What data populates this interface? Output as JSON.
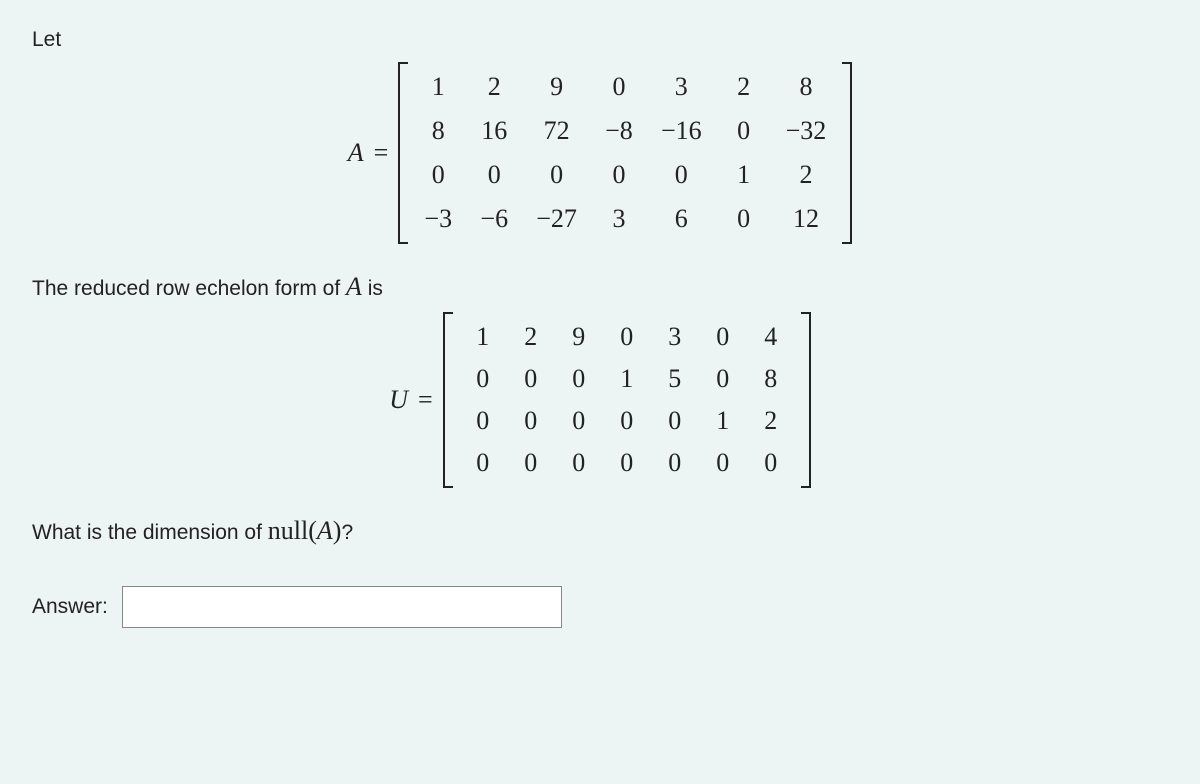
{
  "intro_text": "Let",
  "matrix_a_label": "A",
  "equals": "=",
  "matrix_a": [
    [
      "1",
      "2",
      "9",
      "0",
      "3",
      "2",
      "8"
    ],
    [
      "8",
      "16",
      "72",
      "−8",
      "−16",
      "0",
      "−32"
    ],
    [
      "0",
      "0",
      "0",
      "0",
      "0",
      "1",
      "2"
    ],
    [
      "−3",
      "−6",
      "−27",
      "3",
      "6",
      "0",
      "12"
    ]
  ],
  "rref_text_pre": "The reduced row echelon form of ",
  "rref_text_mid": "A",
  "rref_text_post": " is",
  "matrix_u_label": "U",
  "matrix_u": [
    [
      "1",
      "2",
      "9",
      "0",
      "3",
      "0",
      "4"
    ],
    [
      "0",
      "0",
      "0",
      "1",
      "5",
      "0",
      "8"
    ],
    [
      "0",
      "0",
      "0",
      "0",
      "0",
      "1",
      "2"
    ],
    [
      "0",
      "0",
      "0",
      "0",
      "0",
      "0",
      "0"
    ]
  ],
  "question_pre": "What is the dimension of ",
  "question_null": "null",
  "question_paren_open": "(",
  "question_A": "A",
  "question_paren_close": ")",
  "question_post": "?",
  "answer_label": "Answer:",
  "answer_value": "",
  "chart_data": {
    "type": "table",
    "title": "Linear algebra problem: dimension of null space",
    "matrices": {
      "A": {
        "rows": 4,
        "cols": 7,
        "data": [
          [
            1,
            2,
            9,
            0,
            3,
            2,
            8
          ],
          [
            8,
            16,
            72,
            -8,
            -16,
            0,
            -32
          ],
          [
            0,
            0,
            0,
            0,
            0,
            1,
            2
          ],
          [
            -3,
            -6,
            -27,
            3,
            6,
            0,
            12
          ]
        ]
      },
      "U": {
        "rows": 4,
        "cols": 7,
        "data": [
          [
            1,
            2,
            9,
            0,
            3,
            0,
            4
          ],
          [
            0,
            0,
            0,
            1,
            5,
            0,
            8
          ],
          [
            0,
            0,
            0,
            0,
            0,
            1,
            2
          ],
          [
            0,
            0,
            0,
            0,
            0,
            0,
            0
          ]
        ]
      }
    }
  }
}
